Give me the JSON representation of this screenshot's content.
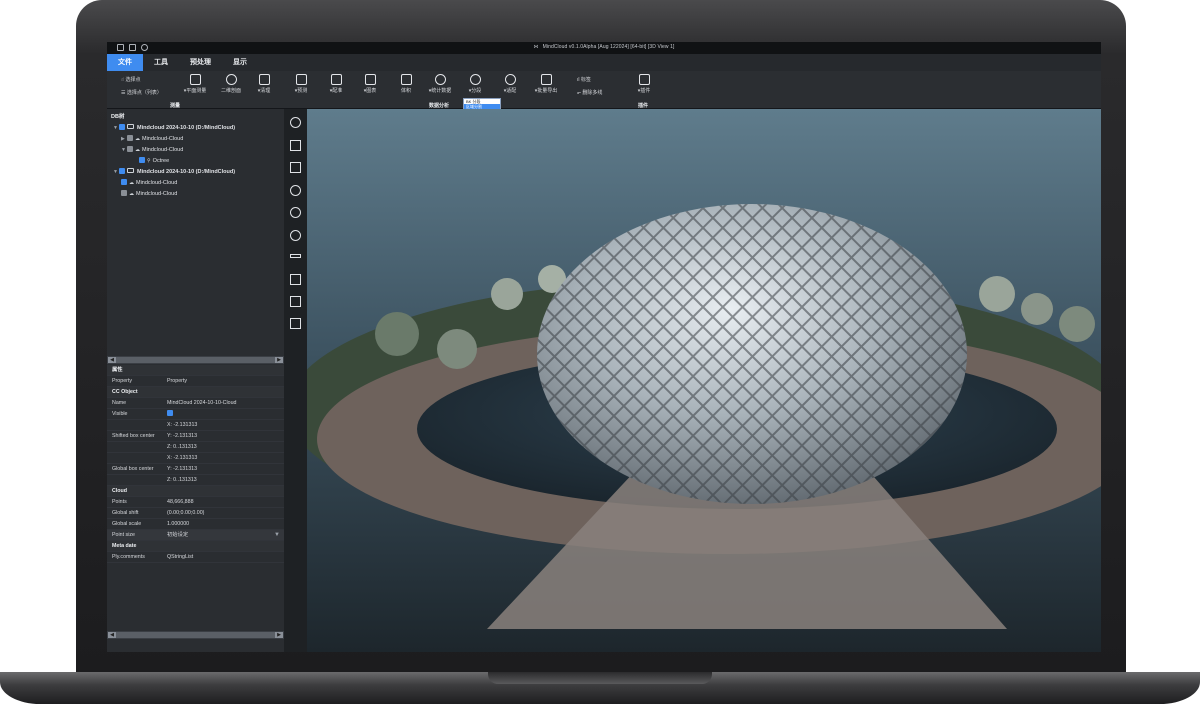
{
  "window": {
    "title": "MindCloud v0.1.0Alpha  [Aug 122024]  [64-bit] [3D View 1]"
  },
  "menubar": {
    "items": [
      "文件",
      "工具",
      "预处理",
      "显示"
    ],
    "active_index": 0
  },
  "ribbon": {
    "pick_point": "选择点",
    "pick_point_list": "选择点（列表）",
    "plane_measure": "▾平面测量",
    "section_2d": "二维剖面",
    "cleanup": "▾清理",
    "predict": "▾预测",
    "register": "▾配准",
    "map": "▾图表",
    "volume": "体积",
    "stats": "▾统计数据",
    "segment": "▾分段",
    "fit": "▾适配",
    "batch_export": "▾批量导出",
    "label": "标签",
    "polyline_remove": "删除多线",
    "plugins": "▾插件",
    "group_measure": "测量",
    "group_data_analysis": "数据分析",
    "group_plugins": "插件",
    "segment_dropdown": [
      "BK 分段",
      "区域分割"
    ]
  },
  "db_tree": {
    "header": "DB树",
    "rows": [
      {
        "label": "Mindcloud 2024-10-10  (D:/MindCloud)",
        "bold": true
      },
      {
        "label": "Mindcloud-Cloud"
      },
      {
        "label": "Mindcloud-Cloud"
      },
      {
        "label": "Octree"
      },
      {
        "label": "Mindcloud 2024-10-10  (D:/MindCloud)",
        "bold": true
      },
      {
        "label": "Mindcloud-Cloud"
      },
      {
        "label": "Mindcloud-Cloud"
      }
    ]
  },
  "properties": {
    "header": "属性",
    "col_key": "Property",
    "col_val": "Property",
    "cc_object": "CC Object",
    "name_key": "Name",
    "name_val": "MindCloud 2024-10-10-Cloud",
    "visible_key": "Visible",
    "x1": "X:  -2.131313",
    "shifted_key": "Shifted box center",
    "y1": "Y:  -2.131313",
    "z1": "Z:  0..131313",
    "x2": "X:  -2.131313",
    "global_box_key": "Global box center",
    "y2": "Y:  -2.131313",
    "z2": "Z:  0..131313",
    "cloud": "Cloud",
    "points_key": "Points",
    "points_val": "48,666,888",
    "global_shift_key": "Global shift",
    "global_shift_val": "(0.00;0.00;0.00)",
    "global_scale_key": "Global scale",
    "global_scale_val": "1.000000",
    "point_size_key": "Point size",
    "point_size_val": "初始设定",
    "meta": "Meta date",
    "ply_key": "Ply.comments",
    "ply_val": "QStringList"
  },
  "view_toolbar": {
    "icons": [
      "eye-icon",
      "fit-icon",
      "zoom-extents-icon",
      "rotate-icon",
      "rotate-center-icon",
      "reset-rotation-icon",
      "ruler-icon",
      "front-view-icon",
      "cube-view-icon",
      "iso-view-icon"
    ]
  },
  "colors": {
    "accent": "#3f8cf0",
    "panel": "#2a2d31"
  }
}
